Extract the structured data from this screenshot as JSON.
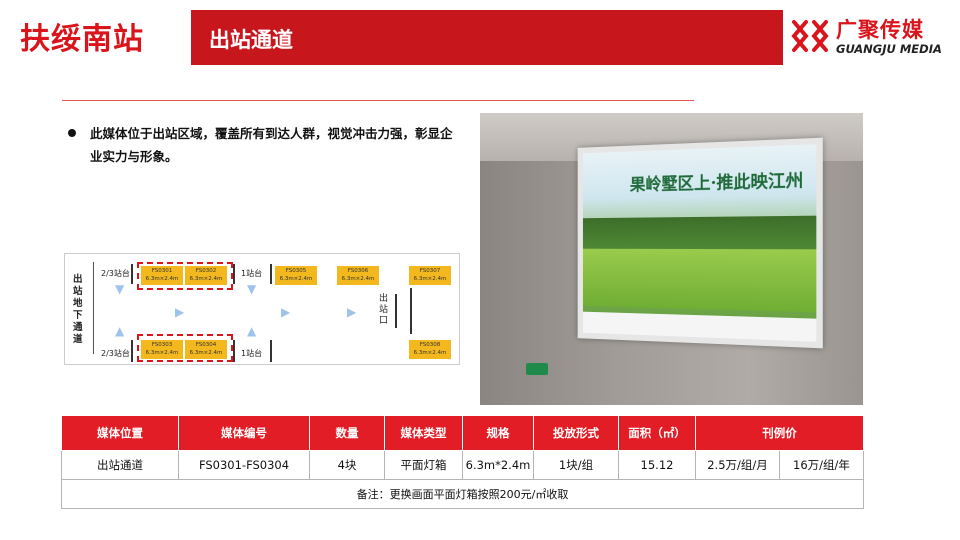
{
  "header": {
    "station": "扶绥南站",
    "section": "出站通道",
    "logo_cn": "广聚传媒",
    "logo_en": "GUANGJU MEDIA"
  },
  "description": "此媒体位于出站区域，覆盖所有到达人群，视觉冲击力强，彰显企业实力与形象。",
  "map": {
    "side_label": "出站地下通道",
    "platform_top_left": "2/3站台",
    "platform_bottom_left": "2/3站台",
    "platform_top_mid": "1站台",
    "platform_bottom_mid": "1站台",
    "exit_label": "出站口",
    "boxes": [
      {
        "code": "FS0301",
        "size": "6.3m×2.4m"
      },
      {
        "code": "FS0302",
        "size": "6.3m×2.4m"
      },
      {
        "code": "FS0305",
        "size": "6.3m×2.4m"
      },
      {
        "code": "FS0306",
        "size": "6.3m×2.4m"
      },
      {
        "code": "FS0307",
        "size": "6.3m×2.4m"
      },
      {
        "code": "FS0303",
        "size": "6.3m×2.4m"
      },
      {
        "code": "FS0304",
        "size": "6.3m×2.4m"
      },
      {
        "code": "FS0308",
        "size": "6.3m×2.4m"
      }
    ]
  },
  "photo": {
    "ad_headline": "果岭墅区上·推此映江州"
  },
  "table": {
    "headers": [
      "媒体位置",
      "媒体编号",
      "数量",
      "媒体类型",
      "规格",
      "投放形式",
      "面积（㎡）",
      "刊例价"
    ],
    "row": [
      "出站通道",
      "FS0301-FS0304",
      "4块",
      "平面灯箱",
      "6.3m*2.4m",
      "1块/组",
      "15.12",
      "2.5万/组/月",
      "16万/组/年"
    ],
    "note": "备注：更换画面平面灯箱按照200元/㎡收取"
  },
  "colors": {
    "brand_red": "#d9141b",
    "header_red": "#c8161d",
    "table_header": "#e21d25",
    "box_yellow": "#f3b81e",
    "arrow_blue": "#9ec4ea"
  }
}
